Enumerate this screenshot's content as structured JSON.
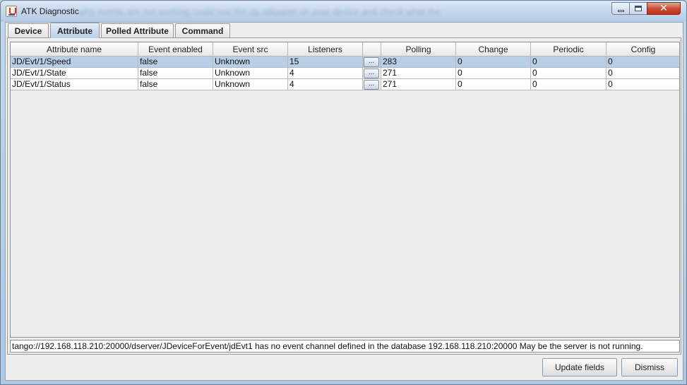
{
  "window": {
    "title": "ATK Diagnostic",
    "background_text": "why events are not working could you fire up atkpanel on your device and check what the",
    "minimize_label": "minimize",
    "maximize_label": "maximize",
    "close_glyph": "✕"
  },
  "tabs": [
    {
      "label": "Device"
    },
    {
      "label": "Attribute"
    },
    {
      "label": "Polled Attribute"
    },
    {
      "label": "Command"
    }
  ],
  "active_tab": "Attribute",
  "table": {
    "columns": [
      "Attribute name",
      "Event enabled",
      "Event src",
      "Listeners",
      "",
      "Polling",
      "Change",
      "Periodic",
      "Config"
    ],
    "rows": [
      {
        "name": "JD/Evt/1/Speed",
        "event_enabled": "false",
        "event_src": "Unknown",
        "listeners": "15",
        "button": "...",
        "polling": "283",
        "change": "0",
        "periodic": "0",
        "config": "0"
      },
      {
        "name": "JD/Evt/1/State",
        "event_enabled": "false",
        "event_src": "Unknown",
        "listeners": "4",
        "button": "...",
        "polling": "271",
        "change": "0",
        "periodic": "0",
        "config": "0"
      },
      {
        "name": "JD/Evt/1/Status",
        "event_enabled": "false",
        "event_src": "Unknown",
        "listeners": "4",
        "button": "...",
        "polling": "271",
        "change": "0",
        "periodic": "0",
        "config": "0"
      }
    ],
    "selected_row": 0
  },
  "message": "tango://192.168.118.210:20000/dserver/JDeviceForEvent/jdEvt1 has no event channel defined in the database 192.168.118.210:20000 May be the server is not running.",
  "buttons": {
    "update": "Update fields",
    "dismiss": "Dismiss"
  },
  "colors": {
    "selection": "#b8cfe5",
    "close_button": "#c9452f",
    "title_bar": "#c3d6ec"
  }
}
